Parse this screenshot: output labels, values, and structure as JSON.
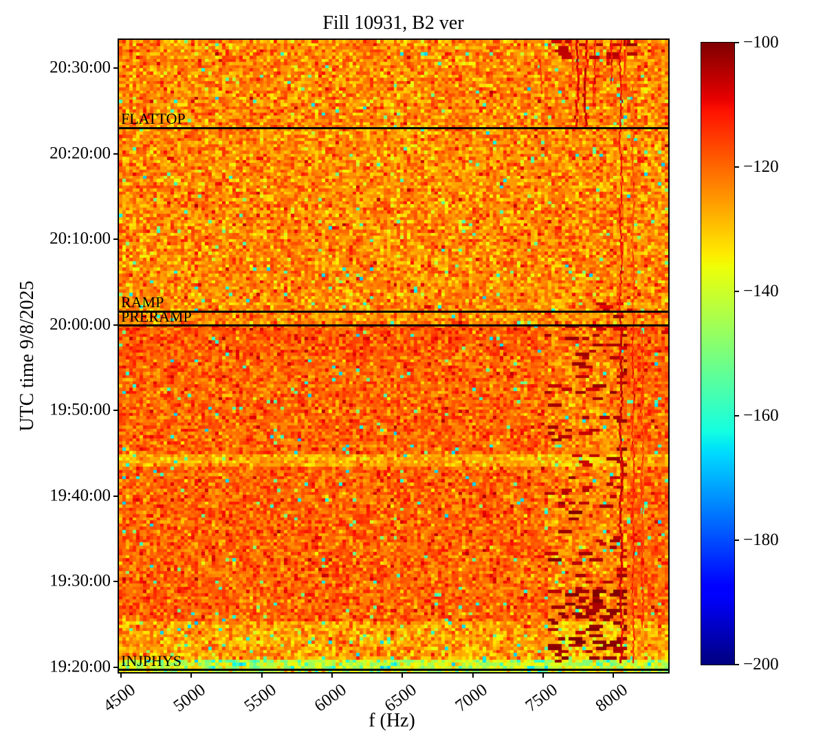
{
  "figure": {
    "bg": "#ffffff",
    "text_color": "#000000"
  },
  "chart_data": {
    "type": "heatmap",
    "title": "Fill 10931, B2 ver",
    "xlabel": "f (Hz)",
    "ylabel": "UTC time 9/8/2025",
    "x_ticks": [
      "4500",
      "5000",
      "5500",
      "6000",
      "6500",
      "7000",
      "7500",
      "8000"
    ],
    "x_tick_values": [
      4500,
      5000,
      5500,
      6000,
      6500,
      7000,
      7500,
      8000
    ],
    "xlim": [
      4485,
      8390
    ],
    "y_ticks": [
      "20:30:00",
      "20:20:00",
      "20:10:00",
      "20:00:00",
      "19:50:00",
      "19:40:00",
      "19:30:00",
      "19:20:00"
    ],
    "ylim": [
      "19:19:26",
      "20:33:18"
    ],
    "grid": false,
    "colorbar": {
      "colormap": "jet",
      "vmin": -200,
      "vmax": -100,
      "tick_labels": [
        "−100",
        "−120",
        "−140",
        "−160",
        "−180",
        "−200"
      ],
      "tick_values": [
        -100,
        -120,
        -140,
        -160,
        -180,
        -200
      ]
    },
    "beam_modes": [
      {
        "label": "FLATTOP",
        "time": "20:23:00"
      },
      {
        "label": "RAMP",
        "time": "20:01:34"
      },
      {
        "label": "PRERAMP",
        "time": "19:59:54"
      },
      {
        "label": "INJPHYS",
        "time": "19:19:41"
      }
    ],
    "texture": {
      "seed": 1337,
      "rows": 200,
      "cols": 160,
      "regions": [
        {
          "name": "upper-flattop",
          "t0": "19:59:54",
          "t1": "20:33:18",
          "mean": -123.5,
          "std": 5.8,
          "teal_prob": 0.012
        },
        {
          "name": "lower-injection",
          "t0": "19:25:30",
          "t1": "19:59:54",
          "mean": -119.5,
          "std": 5.0,
          "teal_prob": 0.015
        },
        {
          "name": "preramp-dark-band",
          "t0": "19:56:30",
          "t1": "19:59:54",
          "mean": -118.0,
          "std": 4.8,
          "teal_prob": 0.01
        },
        {
          "name": "light-band-1944",
          "t0": "19:43:25",
          "t1": "19:44:50",
          "mean": -127.0,
          "std": 4.5,
          "teal_prob": 0.02
        },
        {
          "name": "injection-light",
          "t0": "19:21:00",
          "t1": "19:25:30",
          "mean": -126.0,
          "std": 5.5,
          "teal_prob": 0.03
        },
        {
          "name": "injphys-green-band",
          "t0": "19:19:26",
          "t1": "19:21:00",
          "mean": -141.0,
          "std": 7.0,
          "teal_prob": 0.1
        }
      ],
      "hot_zone": {
        "f0": 7530,
        "f1": 8100,
        "t0": "19:21:00",
        "t1": "19:59:54",
        "mean_shift": -3.5
      },
      "dash_zones": [
        {
          "name": "ramp-prep-dashes",
          "f0": 7530,
          "f1": 8070,
          "t0": "19:29:00",
          "t1": "19:59:50",
          "density": 0.05,
          "dB": -104
        },
        {
          "name": "injection-dense-dashes",
          "f0": 7560,
          "f1": 8060,
          "t0": "19:21:00",
          "t1": "19:29:00",
          "density": 0.2,
          "dB": -102
        },
        {
          "name": "top-edge-dashes",
          "f0": 7570,
          "f1": 8160,
          "t0": "20:31:30",
          "t1": "20:33:15",
          "density": 0.12,
          "dB": -105
        },
        {
          "name": "ramp-right-dashes",
          "f0": 7850,
          "f1": 8120,
          "t0": "20:00:00",
          "t1": "20:02:30",
          "density": 0.08,
          "dB": -106
        }
      ],
      "streaks": [
        {
          "f": 8048,
          "t0": "19:21:00",
          "t1": "19:59:54",
          "dB": -107,
          "w": 3
        },
        {
          "f": 8048,
          "t0": "19:59:54",
          "t1": "20:33:15",
          "dB": -110,
          "w": 2
        },
        {
          "f": 8136,
          "t0": "19:21:00",
          "t1": "20:01:30",
          "dB": -112,
          "w": 2
        },
        {
          "f": 8136,
          "t0": "20:01:30",
          "t1": "20:28:00",
          "dB": -117,
          "w": 2
        },
        {
          "f": 8200,
          "t0": "19:25:00",
          "t1": "20:00:00",
          "dB": -115,
          "w": 2
        },
        {
          "f": 7736,
          "t0": "20:23:30",
          "t1": "20:33:15",
          "dB": -108,
          "w": 3
        },
        {
          "f": 7795,
          "t0": "20:23:30",
          "t1": "20:33:15",
          "dB": -107,
          "w": 3
        },
        {
          "f": 7860,
          "t0": "20:26:30",
          "t1": "20:33:15",
          "dB": -111,
          "w": 2
        },
        {
          "f": 7980,
          "t0": "20:28:30",
          "t1": "20:33:15",
          "dB": -111,
          "w": 2
        },
        {
          "f": 7480,
          "t0": "20:27:30",
          "t1": "20:31:00",
          "dB": -114,
          "w": 2
        },
        {
          "f": 8085,
          "t0": "20:29:30",
          "t1": "20:33:15",
          "dB": -113,
          "w": 2
        },
        {
          "f": 7700,
          "t0": "20:30:00",
          "t1": "20:33:15",
          "dB": -114,
          "w": 2
        }
      ]
    }
  }
}
